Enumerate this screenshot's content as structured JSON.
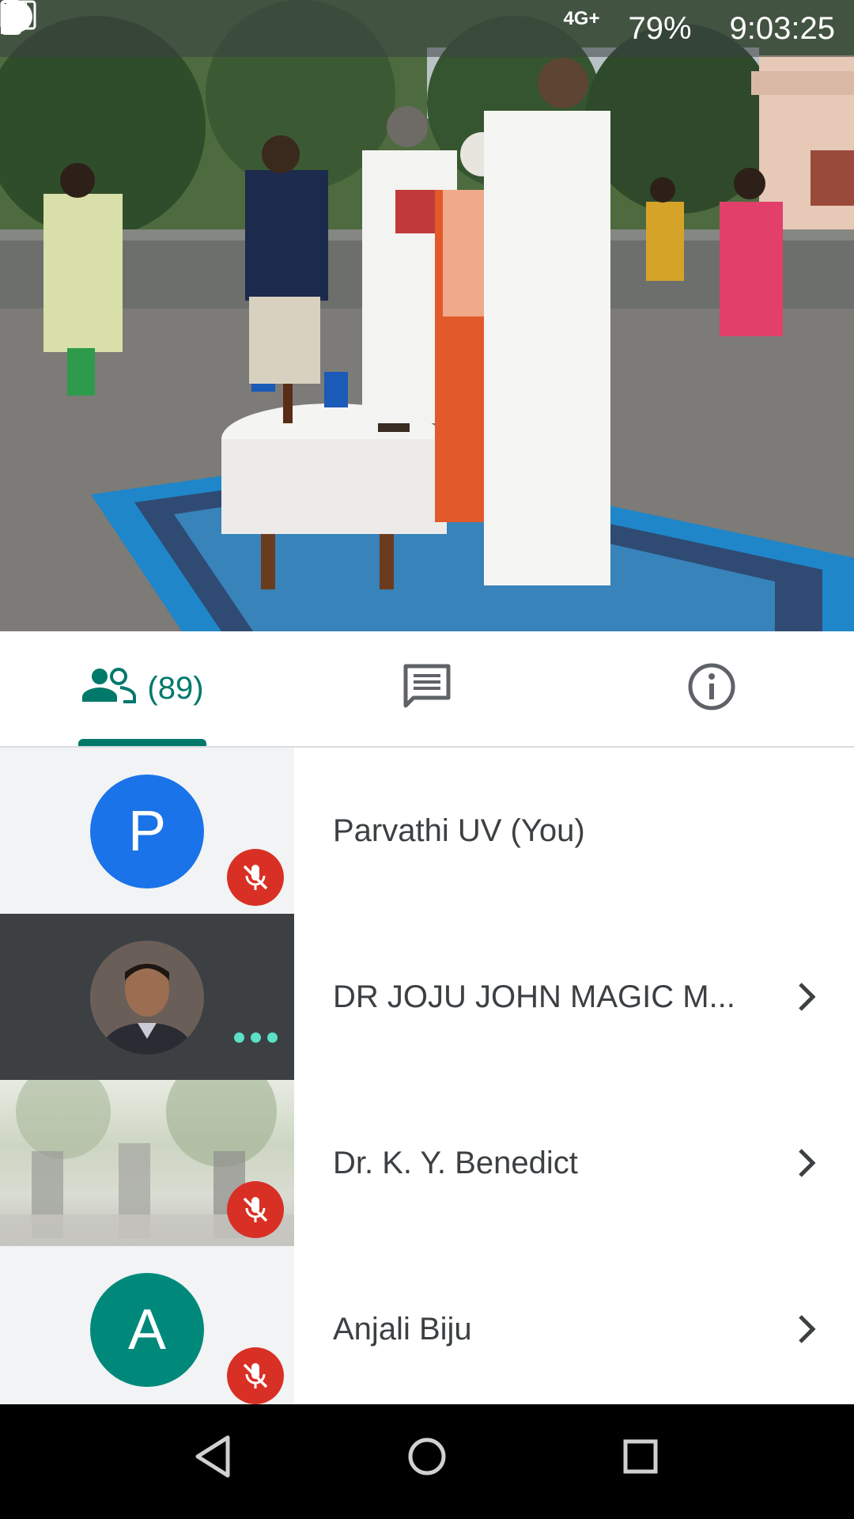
{
  "status_bar": {
    "network": "4G+",
    "battery_percent": "79%",
    "time": "9:03:25",
    "icons": [
      "meet-people-icon",
      "hangouts-icon",
      "phone-icon",
      "do-not-disturb-icon",
      "signal-icon",
      "battery-icon"
    ]
  },
  "tabs": {
    "people_count": "(89)",
    "active": "people",
    "items": [
      "people-icon",
      "chat-icon",
      "info-icon"
    ]
  },
  "participants": [
    {
      "name": "Parvathi UV (You)",
      "initial": "P",
      "avatar_color": "#1a73e8",
      "muted": true
    },
    {
      "name": "DR JOJU JOHN MAGIC M...",
      "initial": "",
      "speaking": true
    },
    {
      "name": "Dr. K. Y. Benedict",
      "initial": "",
      "muted": true
    },
    {
      "name": "Anjali Biju",
      "initial": "A",
      "avatar_color": "#00897b",
      "muted": true
    }
  ],
  "colors": {
    "accent": "#00796b",
    "muted_red": "#d93025"
  },
  "nav": [
    "back-icon",
    "home-icon",
    "recents-icon"
  ]
}
